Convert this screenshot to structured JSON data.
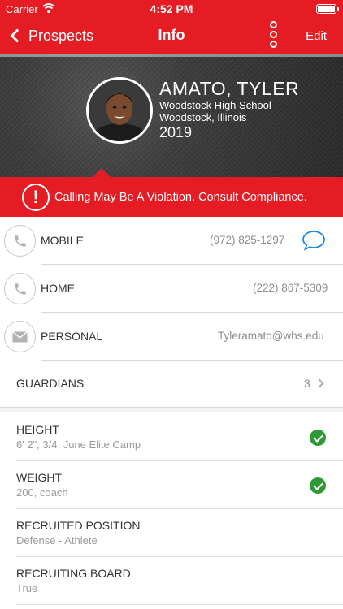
{
  "status_bar": {
    "carrier": "Carrier",
    "time": "4:52 PM"
  },
  "nav": {
    "back_label": "Prospects",
    "title": "Info",
    "edit_label": "Edit"
  },
  "profile": {
    "name": "AMATO, TYLER",
    "school": "Woodstock High School",
    "location": "Woodstock, Illinois",
    "year": "2019"
  },
  "warning": {
    "text": "Calling May Be A Violation. Consult Compliance."
  },
  "contacts": [
    {
      "label": "MOBILE",
      "value": "(972) 825-1297",
      "icon": "phone-icon"
    },
    {
      "label": "HOME",
      "value": "(222) 867-5309",
      "icon": "phone-icon"
    },
    {
      "label": "PERSONAL",
      "value": "Tyleramato@whs.edu",
      "icon": "mail-icon"
    }
  ],
  "guardians": {
    "label": "GUARDIANS",
    "count": "3"
  },
  "details": [
    {
      "title": "HEIGHT",
      "subtitle": "6' 2\", 3/4, June Elite Camp",
      "verified": true
    },
    {
      "title": "WEIGHT",
      "subtitle": "200, coach",
      "verified": true
    },
    {
      "title": "RECRUITED POSITION",
      "subtitle": "Defense - Athlete",
      "verified": false
    },
    {
      "title": "RECRUITING BOARD",
      "subtitle": "True",
      "verified": false
    }
  ],
  "colors": {
    "accent": "#e51c23",
    "verified": "#2e9a36",
    "link": "#1e88e5"
  }
}
